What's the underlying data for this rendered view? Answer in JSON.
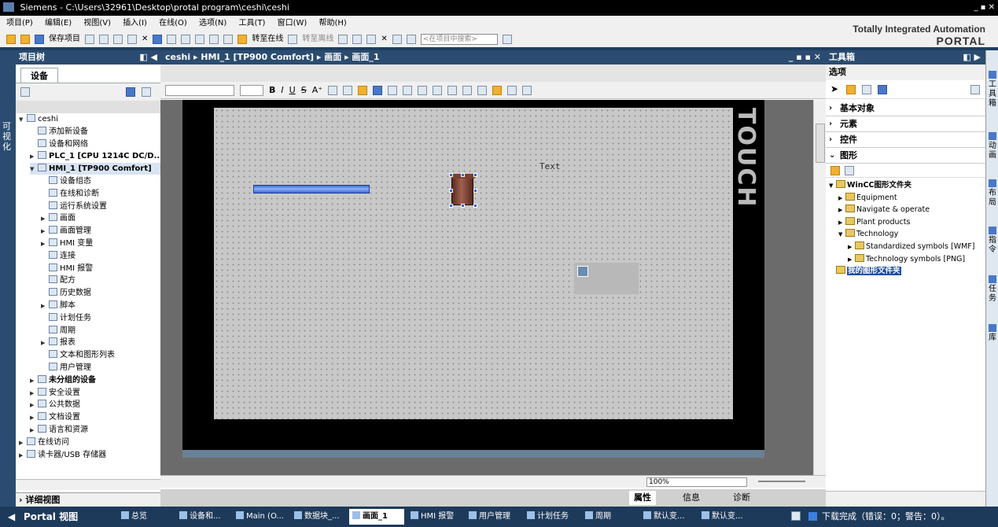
{
  "window": {
    "title": "Siemens - C:\\Users\\32961\\Desktop\\protal program\\ceshi\\ceshi"
  },
  "menu": [
    "项目(P)",
    "编辑(E)",
    "视图(V)",
    "插入(I)",
    "在线(O)",
    "选项(N)",
    "工具(T)",
    "窗口(W)",
    "帮助(H)"
  ],
  "toolbar": {
    "save_label": "保存项目",
    "go_online": "转至在线",
    "go_offline": "转至离线",
    "search_placeholder": "<在项目中搜索>"
  },
  "brand": {
    "line1": "Totally Integrated Automation",
    "line2": "PORTAL"
  },
  "left_vertical_tab": "可视化",
  "project_tree": {
    "title": "项目树",
    "tab": "设备",
    "items": [
      {
        "label": "ceshi",
        "level": 0,
        "arrow": "down"
      },
      {
        "label": "添加新设备",
        "level": 1
      },
      {
        "label": "设备和网络",
        "level": 1
      },
      {
        "label": "PLC_1 [CPU 1214C DC/D...",
        "level": 1,
        "arrow": "right",
        "bold": true
      },
      {
        "label": "HMI_1 [TP900 Comfort]",
        "level": 1,
        "arrow": "down",
        "bold": true,
        "selected": true
      },
      {
        "label": "设备组态",
        "level": 2
      },
      {
        "label": "在线和诊断",
        "level": 2
      },
      {
        "label": "运行系统设置",
        "level": 2
      },
      {
        "label": "画面",
        "level": 2,
        "arrow": "right"
      },
      {
        "label": "画面管理",
        "level": 2,
        "arrow": "right"
      },
      {
        "label": "HMI 变量",
        "level": 2,
        "arrow": "right"
      },
      {
        "label": "连接",
        "level": 2
      },
      {
        "label": "HMI 报警",
        "level": 2
      },
      {
        "label": "配方",
        "level": 2
      },
      {
        "label": "历史数据",
        "level": 2
      },
      {
        "label": "脚本",
        "level": 2,
        "arrow": "right"
      },
      {
        "label": "计划任务",
        "level": 2
      },
      {
        "label": "周期",
        "level": 2
      },
      {
        "label": "报表",
        "level": 2,
        "arrow": "right"
      },
      {
        "label": "文本和图形列表",
        "level": 2
      },
      {
        "label": "用户管理",
        "level": 2
      },
      {
        "label": "未分组的设备",
        "level": 1,
        "arrow": "right",
        "bold": true
      },
      {
        "label": "安全设置",
        "level": 1,
        "arrow": "right"
      },
      {
        "label": "公共数据",
        "level": 1,
        "arrow": "right"
      },
      {
        "label": "文档设置",
        "level": 1,
        "arrow": "right"
      },
      {
        "label": "语言和资源",
        "level": 1,
        "arrow": "right"
      },
      {
        "label": "在线访问",
        "level": 0,
        "arrow": "right"
      },
      {
        "label": "读卡器/USB 存储器",
        "level": 0,
        "arrow": "right"
      }
    ],
    "detail_view": "详细视图"
  },
  "editor": {
    "breadcrumb": "ceshi ▸ HMI_1 [TP900 Comfort] ▸ 画面 ▸ 画面_1",
    "format_tools": [
      "B",
      "I",
      "U",
      "S",
      "A⁺"
    ],
    "touch_label": "TOUCH",
    "text_object": "Text",
    "zoom": "100%"
  },
  "inspector_tabs": [
    "属性",
    "信息",
    "诊断"
  ],
  "toolbox": {
    "title": "工具箱",
    "options": "选项",
    "panes": [
      "基本对象",
      "元素",
      "控件",
      "图形"
    ],
    "graphics_tree": [
      {
        "label": "WinCC图形文件夹",
        "level": 0,
        "arrow": "down",
        "bold": true
      },
      {
        "label": "Equipment",
        "level": 1,
        "arrow": "right"
      },
      {
        "label": "Navigate & operate",
        "level": 1,
        "arrow": "right"
      },
      {
        "label": "Plant products",
        "level": 1,
        "arrow": "right"
      },
      {
        "label": "Technology",
        "level": 1,
        "arrow": "down"
      },
      {
        "label": "Standardized symbols [WMF]",
        "level": 2,
        "arrow": "right"
      },
      {
        "label": "Technology symbols [PNG]",
        "level": 2,
        "arrow": "right"
      },
      {
        "label": "我的图形文件夹",
        "level": 0,
        "selected": true,
        "bold": true
      }
    ]
  },
  "right_tabs": [
    "工具箱",
    "动画",
    "布局",
    "指令",
    "任务",
    "库"
  ],
  "statusbar": {
    "portal_view": "Portal 视图",
    "buttons": [
      "总览",
      "设备和...",
      "Main (O...",
      "数据块_...",
      "画面_1",
      "HMI 报警",
      "用户管理",
      "计划任务",
      "周期",
      "默认变...",
      "默认变..."
    ],
    "active_button": "画面_1",
    "status_text": "下载完成（错误：0；警告：0）。"
  }
}
